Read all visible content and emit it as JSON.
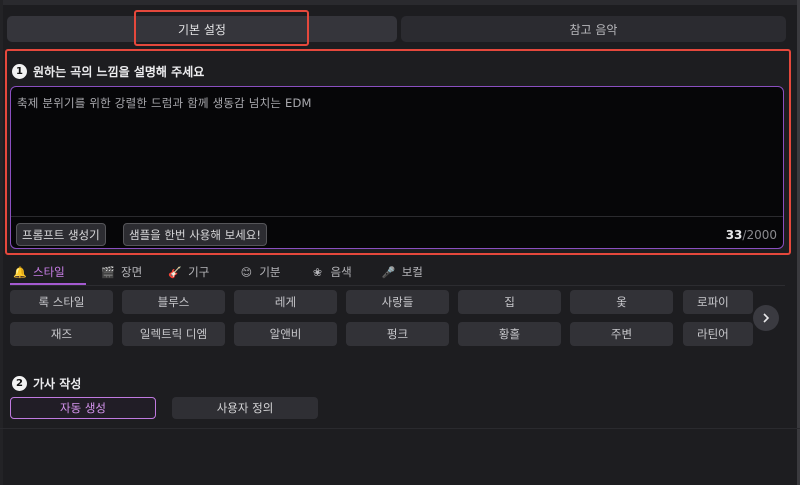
{
  "tabs": [
    {
      "label": "기본 설정",
      "active": true
    },
    {
      "label": "참고 음악",
      "active": false
    }
  ],
  "prompt_section": {
    "number": "1",
    "title": "원하는 곡의 느낌을 설명해 주세요",
    "text": "축제 분위기를 위한 강렬한 드럼과 함께 생동감 넘치는 EDM",
    "buttons": {
      "generator": "프롬프트 생성기",
      "sample": "샘플을 한번 사용해 보세요!"
    },
    "counter": {
      "current": "33",
      "max": "/2000"
    }
  },
  "categories": [
    {
      "label": "스타일",
      "icon": "bell-icon",
      "glyph": "🔔",
      "active": true
    },
    {
      "label": "장면",
      "icon": "clapperboard-icon",
      "glyph": "🎬",
      "active": false
    },
    {
      "label": "기구",
      "icon": "guitar-icon",
      "glyph": "🎸",
      "active": false
    },
    {
      "label": "기분",
      "icon": "smiley-icon",
      "glyph": "😊",
      "active": false
    },
    {
      "label": "음색",
      "icon": "flower-icon",
      "glyph": "❀",
      "active": false
    },
    {
      "label": "보컬",
      "icon": "microphone-icon",
      "glyph": "🎤",
      "active": false
    }
  ],
  "style_chips": {
    "row1": [
      "록 스타일",
      "블루스",
      "레게",
      "사랑들",
      "집",
      "옻",
      "로파이"
    ],
    "row2": [
      "재즈",
      "일렉트릭 디엠",
      "알앤비",
      "펑크",
      "황홀",
      "주변",
      "라틴어"
    ]
  },
  "lyrics_section": {
    "number": "2",
    "title": "가사 작성",
    "auto": "자동 생성",
    "custom": "사용자 정의"
  },
  "colors": {
    "accent": "#c07ae0",
    "highlight_box": "#e5483c",
    "background": "#1d1d20"
  }
}
